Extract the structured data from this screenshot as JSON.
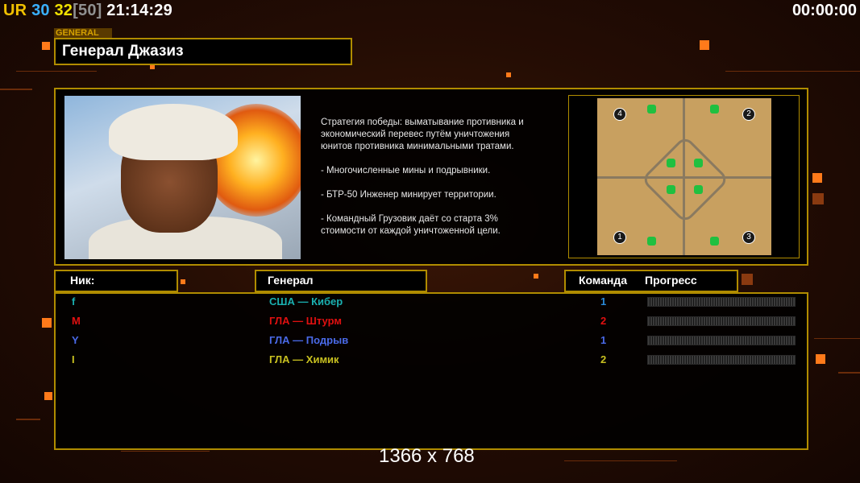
{
  "hud": {
    "ur_label": "UR",
    "fps1": "30",
    "fps2": "32",
    "fps_limit": "[50]",
    "clock": "21:14:29",
    "timer": "00:00:00"
  },
  "general": {
    "tag": "GENERAL",
    "title": "Генерал Джазиз",
    "description": [
      "Стратегия победы: выматывание противника и\n экономический перевес путём уничтожения\n юнитов противника минимальными тратами.",
      "- Многочисленные мины и подрывники.",
      "- БТР-50 Инженер минирует территории.",
      "- Командный Грузовик даёт со старта 3%\n стоимости от каждой уничтоженной цели."
    ]
  },
  "map": {
    "start_positions": [
      "4",
      "2",
      "1",
      "3"
    ]
  },
  "table": {
    "nick_header": "Ник:",
    "general_header": "Генерал",
    "team_header": "Команда",
    "progress_header": "Прогресс",
    "players": [
      {
        "nick": "f",
        "general": "США — Кибер",
        "team": "1",
        "color": "#1ab0b0",
        "team_color": "#2a8ad8",
        "progress": 0
      },
      {
        "nick": "M",
        "general": "ГЛА — Штурм",
        "team": "2",
        "color": "#e01010",
        "team_color": "#e01010",
        "progress": 0
      },
      {
        "nick": "Y",
        "general": "ГЛА — Подрыв",
        "team": "1",
        "color": "#4a6ae8",
        "team_color": "#4a6ae8",
        "progress": 0
      },
      {
        "nick": "I",
        "general": "ГЛА — Химик",
        "team": "2",
        "color": "#c8c020",
        "team_color": "#c8c020",
        "progress": 0
      }
    ]
  },
  "resolution": "1366 x 768",
  "colors": {
    "accent": "#b08c00",
    "ur": "#f0c000",
    "fps1": "#3ab0ff",
    "fps2": "#f0e000",
    "fps_limit": "#909090"
  }
}
